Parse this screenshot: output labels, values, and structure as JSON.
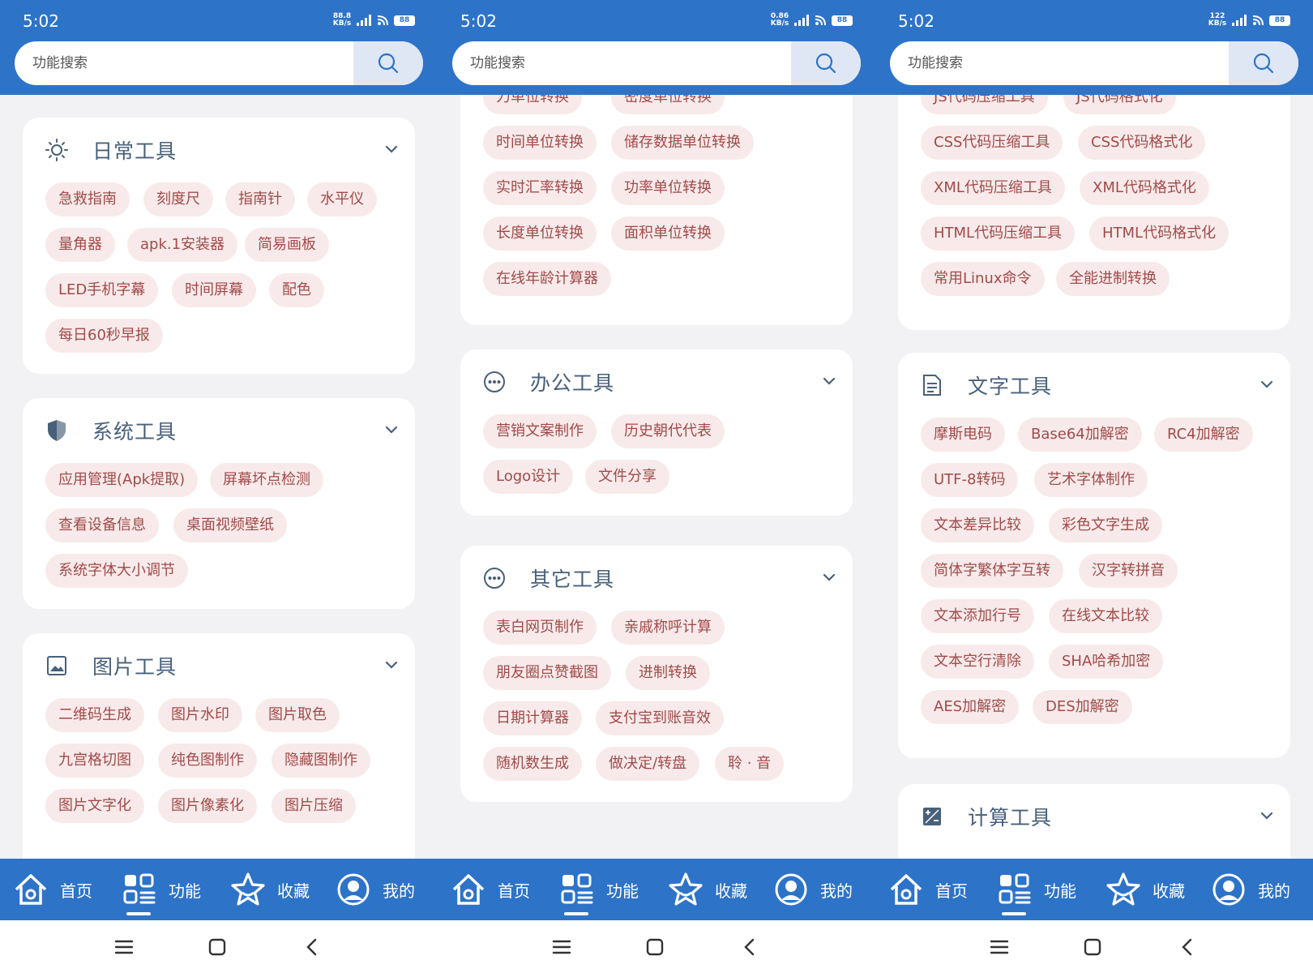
{
  "screens": [
    {
      "status": {
        "time": "5:02",
        "net_speed_value": "88.8",
        "net_speed_unit": "KB/s",
        "battery": "88"
      },
      "search": {
        "placeholder": "功能搜索"
      },
      "cards": [
        {
          "title": "日常工具",
          "icon": "sun-icon",
          "items": [
            "急救指南",
            "刻度尺",
            "指南针",
            "水平仪",
            "量角器",
            "apk.1安装器",
            "简易画板",
            "LED手机字幕",
            "时间屏幕",
            "配色",
            "每日60秒早报"
          ]
        },
        {
          "title": "系统工具",
          "icon": "shield-icon",
          "items": [
            "应用管理(Apk提取)",
            "屏幕坏点检测",
            "查看设备信息",
            "桌面视频壁纸",
            "系统字体大小调节"
          ]
        },
        {
          "title": "图片工具",
          "icon": "image-icon",
          "items": [
            "二维码生成",
            "图片水印",
            "图片取色",
            "九宫格切图",
            "纯色图制作",
            "隐藏图制作",
            "图片文字化",
            "图片像素化",
            "图片压缩"
          ]
        }
      ]
    },
    {
      "status": {
        "time": "5:02",
        "net_speed_value": "0.86",
        "net_speed_unit": "KB/s",
        "battery": "88"
      },
      "search": {
        "placeholder": "功能搜索"
      },
      "cards": [
        {
          "title": "",
          "icon": "",
          "items": [
            "力单位转换",
            "密度单位转换",
            "时间单位转换",
            "储存数据单位转换",
            "实时汇率转换",
            "功率单位转换",
            "长度单位转换",
            "面积单位转换",
            "在线年龄计算器"
          ]
        },
        {
          "title": "办公工具",
          "icon": "dots-icon",
          "items": [
            "营销文案制作",
            "历史朝代代表",
            "Logo设计",
            "文件分享"
          ]
        },
        {
          "title": "其它工具",
          "icon": "dots-icon",
          "items": [
            "表白网页制作",
            "亲戚称呼计算",
            "朋友圈点赞截图",
            "进制转换",
            "日期计算器",
            "支付宝到账音效",
            "随机数生成",
            "做决定/转盘",
            "聆 · 音"
          ]
        }
      ]
    },
    {
      "status": {
        "time": "5:02",
        "net_speed_value": "122",
        "net_speed_unit": "KB/s",
        "battery": "88"
      },
      "search": {
        "placeholder": "功能搜索"
      },
      "cards": [
        {
          "title": "",
          "icon": "",
          "items": [
            "JS代码压缩工具",
            "JS代码格式化",
            "CSS代码压缩工具",
            "CSS代码格式化",
            "XML代码压缩工具",
            "XML代码格式化",
            "HTML代码压缩工具",
            "HTML代码格式化",
            "常用Linux命令",
            "全能进制转换"
          ]
        },
        {
          "title": "文字工具",
          "icon": "document-icon",
          "items": [
            "摩斯电码",
            "Base64加解密",
            "RC4加解密",
            "UTF-8转码",
            "艺术字体制作",
            "文本差异比较",
            "彩色文字生成",
            "简体字繁体字互转",
            "汉字转拼音",
            "文本添加行号",
            "在线文本比较",
            "文本空行清除",
            "SHA哈希加密",
            "AES加解密",
            "DES加解密"
          ]
        },
        {
          "title": "计算工具",
          "icon": "calculator-icon",
          "items": []
        }
      ]
    }
  ],
  "nav": {
    "home": "首页",
    "features": "功能",
    "favorites": "收藏",
    "mine": "我的"
  },
  "colors": {
    "primary": "#2d73c8",
    "chip_bg": "#f8eaea",
    "chip_text": "#a14a4a",
    "title_text": "#48607a"
  }
}
